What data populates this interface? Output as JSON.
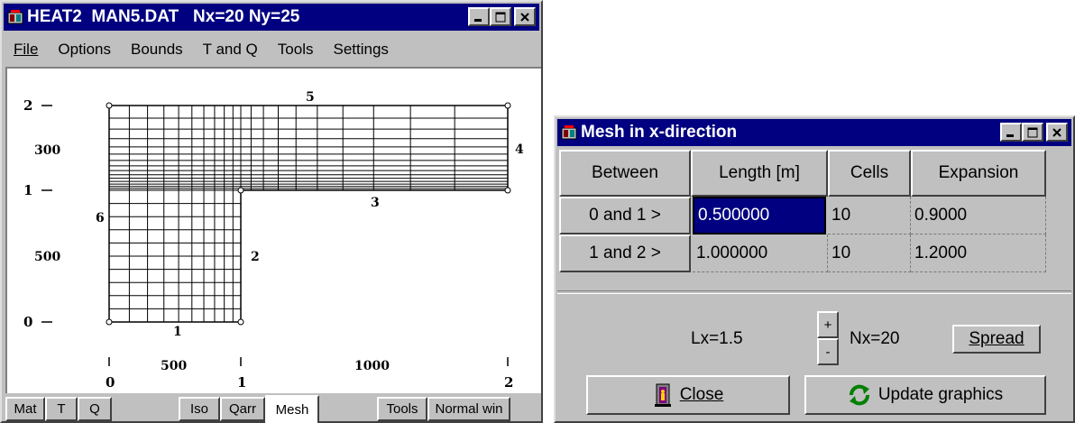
{
  "main_window": {
    "title": "HEAT2  MAN5.DAT   Nx=20 Ny=25",
    "menu": [
      "File",
      "Options",
      "Bounds",
      "T and Q",
      "Tools",
      "Settings"
    ],
    "tabs": [
      "Mat",
      "T",
      "Q",
      "Iso",
      "Qarr",
      "Mesh",
      "Tools",
      "Normal win"
    ],
    "active_tab": "Mesh",
    "plot": {
      "y_ticks": [
        "2",
        "1",
        "0"
      ],
      "y_segment_labels": [
        "300",
        "500"
      ],
      "x_ticks": [
        "0",
        "1",
        "2"
      ],
      "x_segment_labels": [
        "500",
        "1000"
      ],
      "boundary_labels": [
        "5",
        "4",
        "3",
        "6",
        "2",
        "1"
      ]
    }
  },
  "mesh_dialog": {
    "title": "Mesh in x-direction",
    "columns": [
      "Between",
      "Length [m]",
      "Cells",
      "Expansion"
    ],
    "rows": [
      {
        "between": "0 and 1 >",
        "length": "0.500000",
        "cells": "10",
        "expansion": "0.9000"
      },
      {
        "between": "1 and 2 >",
        "length": "1.000000",
        "cells": "10",
        "expansion": "1.2000"
      }
    ],
    "lx_label": "Lx=1.5",
    "plus": "+",
    "minus": "-",
    "nx_label": "Nx=20",
    "spread_button": "Spread",
    "close_button": "Close",
    "update_button": "Update graphics"
  }
}
